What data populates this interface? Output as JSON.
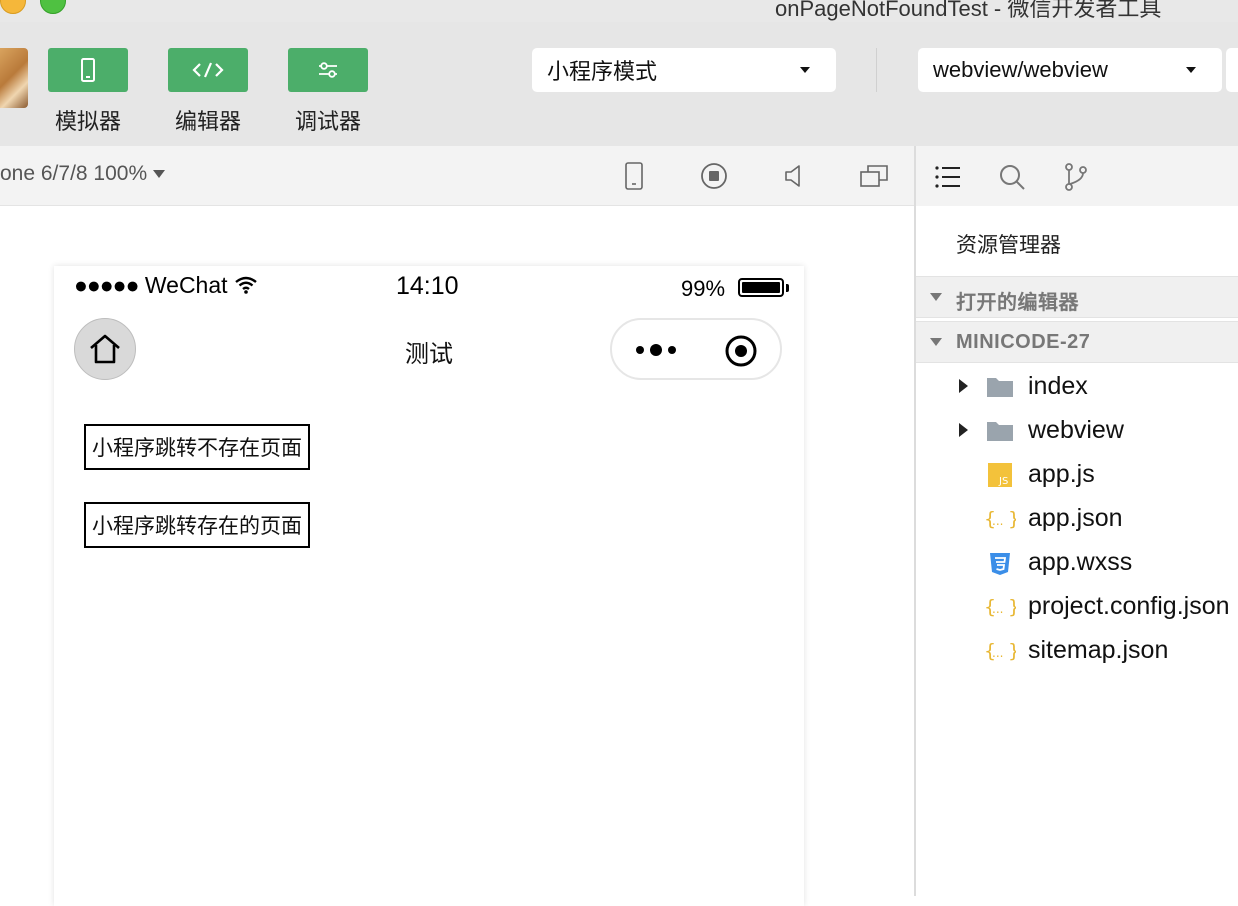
{
  "window": {
    "title": "onPageNotFoundTest - 微信开发者工具"
  },
  "toolbar": {
    "simulator_label": "模拟器",
    "editor_label": "编辑器",
    "debugger_label": "调试器",
    "mode_select": "小程序模式",
    "page_select": "webview/webview",
    "accent_color": "#4cae6a"
  },
  "simulator": {
    "device": "one 6/7/8 100%",
    "status_bar": {
      "carrier": "WeChat",
      "signal_dots": "●●●●●",
      "time": "14:10",
      "battery": "99%"
    },
    "nav_title": "测试",
    "buttons": [
      "小程序跳转不存在页面",
      "小程序跳转存在的页面"
    ]
  },
  "explorer": {
    "title": "资源管理器",
    "sections": {
      "open_editors": "打开的编辑器",
      "project": "MINICODE-27"
    },
    "files": [
      {
        "name": "index",
        "icon": "folder-icon",
        "expandable": true
      },
      {
        "name": "webview",
        "icon": "folder-icon",
        "expandable": true
      },
      {
        "name": "app.js",
        "icon": "js-file-icon",
        "expandable": false
      },
      {
        "name": "app.json",
        "icon": "json-file-icon",
        "expandable": false
      },
      {
        "name": "app.wxss",
        "icon": "css-file-icon",
        "expandable": false
      },
      {
        "name": "project.config.json",
        "icon": "json-file-icon",
        "expandable": false
      },
      {
        "name": "sitemap.json",
        "icon": "json-file-icon",
        "expandable": false
      }
    ]
  }
}
